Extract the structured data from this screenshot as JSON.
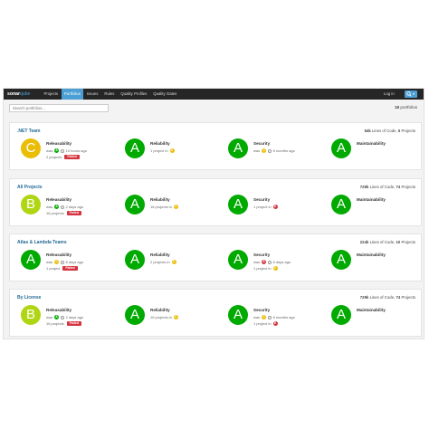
{
  "colors": {
    "A": "#00aa00",
    "B": "#b0d513",
    "C": "#eabe06",
    "D": "#ed7d20",
    "E": "#d4333f",
    "accent": "#4b9fd5",
    "title": "#236a97"
  },
  "navbar": {
    "logo_text": "sonar",
    "logo_suffix": "qube",
    "items": [
      "Projects",
      "Portfolios",
      "Issues",
      "Rules",
      "Quality Profiles",
      "Quality Gates"
    ],
    "active_index": 1,
    "login_label": "Log in",
    "search_icon": "search-icon"
  },
  "toolbar": {
    "search_placeholder": "Search portfolios...",
    "count_value": "18",
    "count_label": "portfolios"
  },
  "portfolios": [
    {
      "name": ".NET Team",
      "loc": "54k",
      "loc_label": "Lines of Code,",
      "projects_count": "5",
      "projects_label": "Projects",
      "releasability": {
        "rating": "C",
        "title": "Releasability",
        "was_label": "was",
        "was_rating": "A",
        "ago": "19 hours ago",
        "projects_text": "2 projects",
        "status": "Failed"
      },
      "reliability": {
        "rating": "A",
        "title": "Reliability",
        "projects_text": "1 project in",
        "dot_rating": "C"
      },
      "security": {
        "rating": "A",
        "title": "Security",
        "was_label": "was",
        "was_rating": "C",
        "ago": "6 months ago"
      },
      "maintainability": {
        "rating": "A",
        "title": "Maintainability"
      }
    },
    {
      "name": "All Projects",
      "loc": "729k",
      "loc_label": "Lines of Code,",
      "projects_count": "74",
      "projects_label": "Projects",
      "releasability": {
        "rating": "B",
        "title": "Releasability",
        "was_label": "was",
        "was_rating": "A",
        "ago": "2 days ago",
        "projects_text": "16 projects",
        "status": "Failed"
      },
      "reliability": {
        "rating": "A",
        "title": "Reliability",
        "projects_text": "16 projects in",
        "dot_rating": "C"
      },
      "security": {
        "rating": "A",
        "title": "Security",
        "projects_text": "1 project in",
        "dot_rating": "E"
      },
      "maintainability": {
        "rating": "A",
        "title": "Maintainability"
      }
    },
    {
      "name": "Atlas & Lambda Teams",
      "loc": "224k",
      "loc_label": "Lines of Code,",
      "projects_count": "10",
      "projects_label": "Projects",
      "releasability": {
        "rating": "A",
        "title": "Releasability",
        "was_label": "was",
        "was_rating": "C",
        "ago": "6 days ago",
        "projects_text": "1 project",
        "status": "Failed"
      },
      "reliability": {
        "rating": "A",
        "title": "Reliability",
        "projects_text": "2 projects in",
        "dot_rating": "C"
      },
      "security": {
        "rating": "A",
        "title": "Security",
        "was_label": "was",
        "was_rating": "E",
        "ago": "6 days ago",
        "projects_text": "1 project in",
        "dot_rating": "C"
      },
      "maintainability": {
        "rating": "A",
        "title": "Maintainability"
      }
    },
    {
      "name": "By License",
      "loc": "729k",
      "loc_label": "Lines of Code,",
      "projects_count": "74",
      "projects_label": "Projects",
      "releasability": {
        "rating": "B",
        "title": "Releasability",
        "was_label": "was",
        "was_rating": "A",
        "ago": "2 days ago",
        "projects_text": "16 projects",
        "status": "Failed"
      },
      "reliability": {
        "rating": "A",
        "title": "Reliability",
        "projects_text": "16 projects in",
        "dot_rating": "C"
      },
      "security": {
        "rating": "A",
        "title": "Security",
        "was_label": "was",
        "was_rating": "C",
        "ago": "6 months ago",
        "projects_text": "1 project in",
        "dot_rating": "E"
      },
      "maintainability": {
        "rating": "A",
        "title": "Maintainability"
      }
    }
  ]
}
